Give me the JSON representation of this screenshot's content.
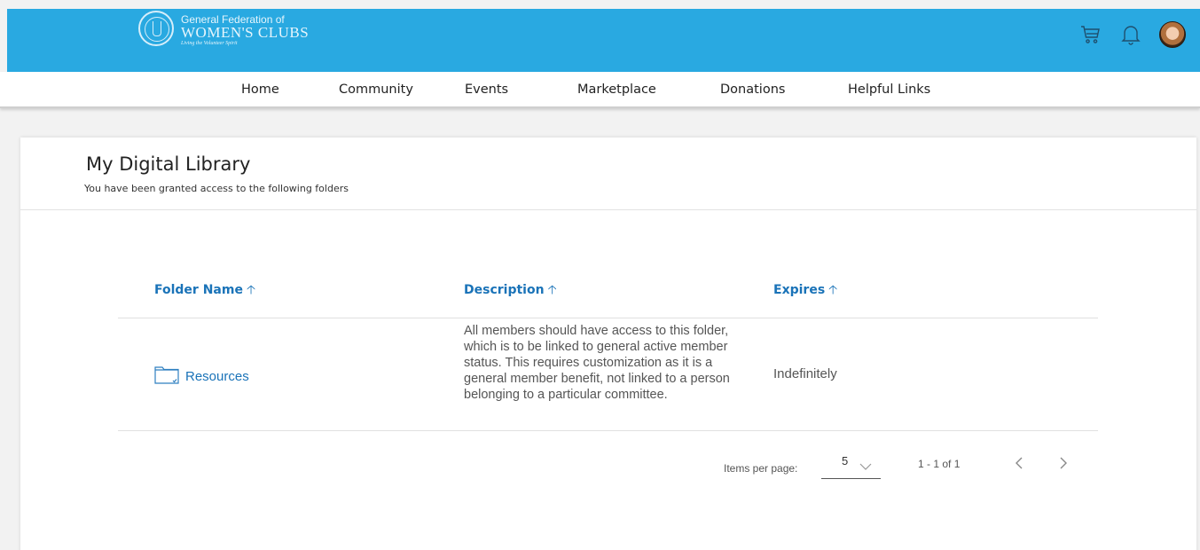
{
  "header": {
    "logo": {
      "line1": "General Federation of",
      "line2": "WOMEN'S CLUBS",
      "tagline": "Living the Volunteer Spirit"
    },
    "icons": [
      "cart-icon",
      "bell-icon",
      "avatar"
    ],
    "colors": {
      "bar": "#29a9e1"
    }
  },
  "nav": {
    "items": [
      "Home",
      "Community",
      "Events",
      "Marketplace",
      "Donations",
      "Helpful Links"
    ]
  },
  "library": {
    "title": "My Digital Library",
    "subtitle": "You have been granted access to the following folders",
    "columns": [
      {
        "label": "Folder Name",
        "sort_icon": "arrow-up-icon"
      },
      {
        "label": "Description",
        "sort_icon": "arrow-up-icon"
      },
      {
        "label": "Expires",
        "sort_icon": "arrow-up-icon"
      }
    ],
    "rows": [
      {
        "folder_name": "Resources",
        "icon": "folder-icon",
        "description": "All members should have access to this folder, which is to be linked to general active member status. This requires customization as it is a general member benefit, not linked to a person belonging to a particular committee.",
        "expires": "Indefinitely"
      }
    ]
  },
  "pagination": {
    "items_per_page_label": "Items per page:",
    "items_per_page": "5",
    "range": "1 - 1 of 1"
  }
}
